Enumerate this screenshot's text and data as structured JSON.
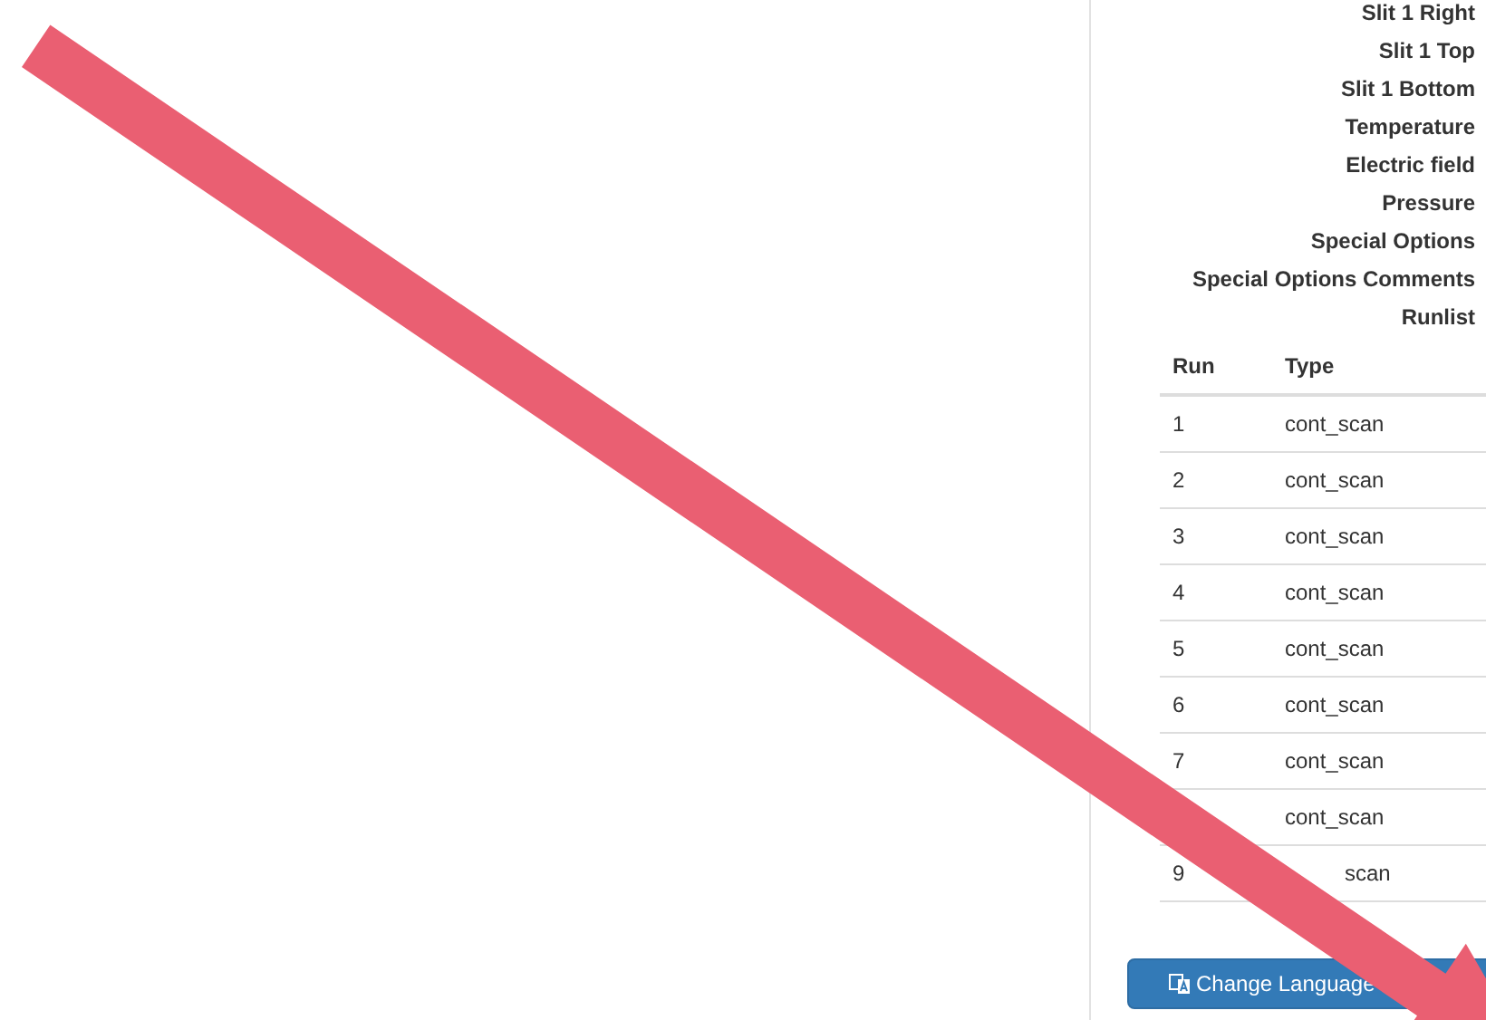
{
  "fields": [
    "Slit 1 Right",
    "Slit 1 Top",
    "Slit 1 Bottom",
    "Temperature",
    "Electric field",
    "Pressure",
    "Special Options",
    "Special Options Comments",
    "Runlist"
  ],
  "runlist": {
    "columns": [
      "Run",
      "Type"
    ],
    "rows": [
      {
        "run": "1",
        "type": "cont_scan"
      },
      {
        "run": "2",
        "type": "cont_scan"
      },
      {
        "run": "3",
        "type": "cont_scan"
      },
      {
        "run": "4",
        "type": "cont_scan"
      },
      {
        "run": "5",
        "type": "cont_scan"
      },
      {
        "run": "6",
        "type": "cont_scan"
      },
      {
        "run": "7",
        "type": "cont_scan"
      },
      {
        "type": "cont_scan"
      },
      {
        "run": "9",
        "type": "scan",
        "kind": "partial"
      }
    ]
  },
  "button": {
    "label": "Change Language"
  }
}
